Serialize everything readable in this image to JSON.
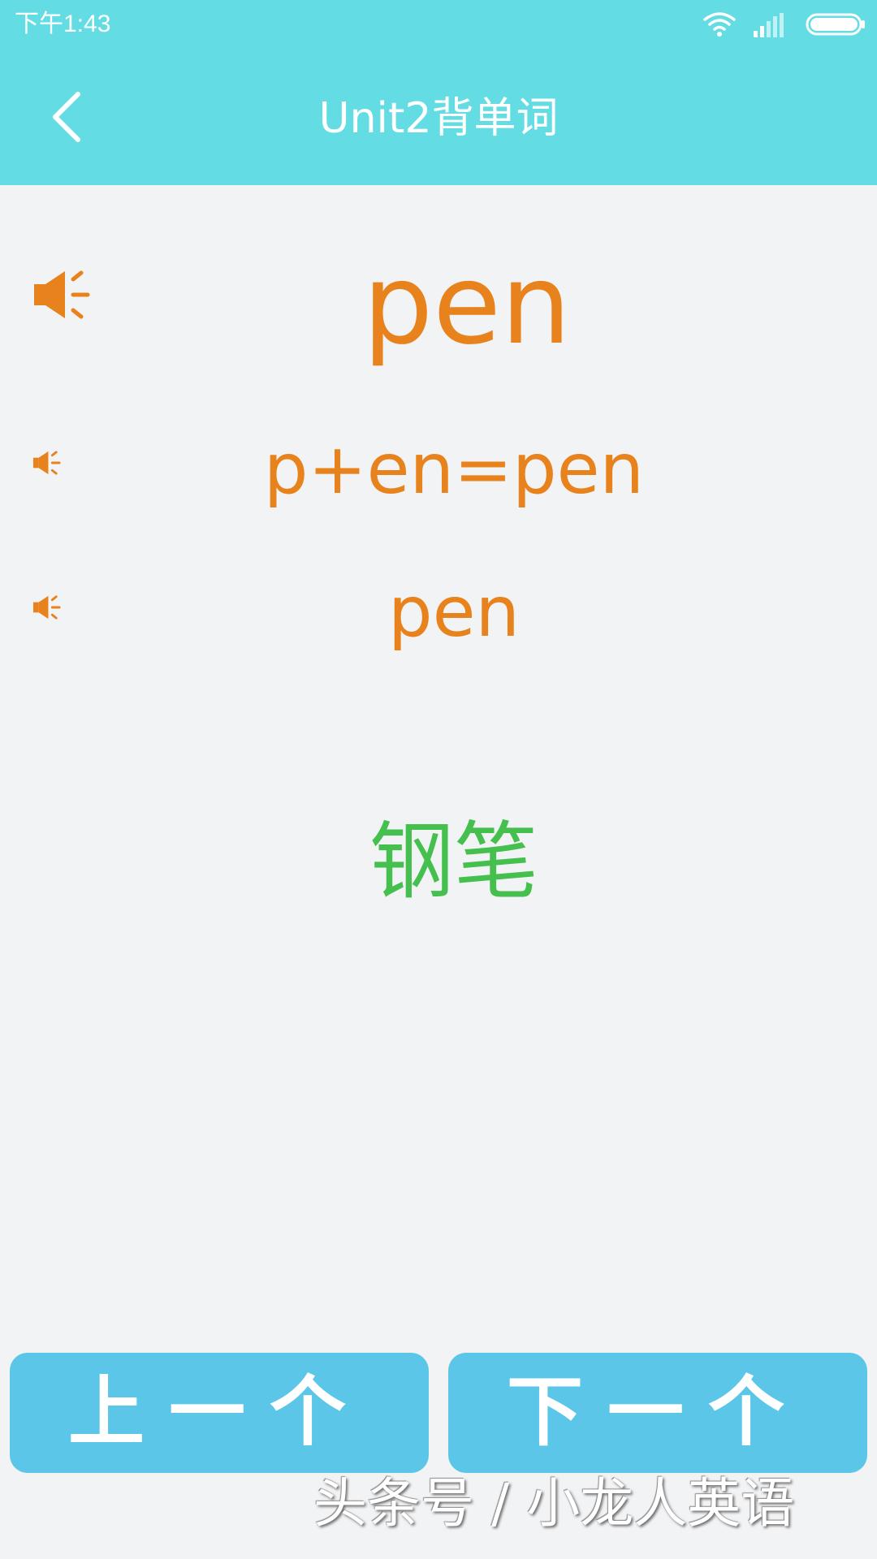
{
  "status_bar": {
    "time": "下午1:43",
    "icons": [
      "wifi-icon",
      "signal-icon",
      "battery-icon"
    ]
  },
  "header": {
    "back_icon": "chevron-left-icon",
    "title": "Unit2背单词"
  },
  "word": {
    "main": "pen",
    "phonics": "p+en=pen",
    "repeat": "pen",
    "meaning": "钢笔"
  },
  "buttons": {
    "prev_label": "上一个",
    "next_label": "下一个"
  },
  "watermark": "头条号 / 小龙人英语",
  "colors": {
    "header_bg": "#63dce3",
    "word_orange": "#e8821c",
    "meaning_green": "#45bf4e",
    "button_blue": "#5bc6e8",
    "page_bg": "#f2f3f5"
  }
}
